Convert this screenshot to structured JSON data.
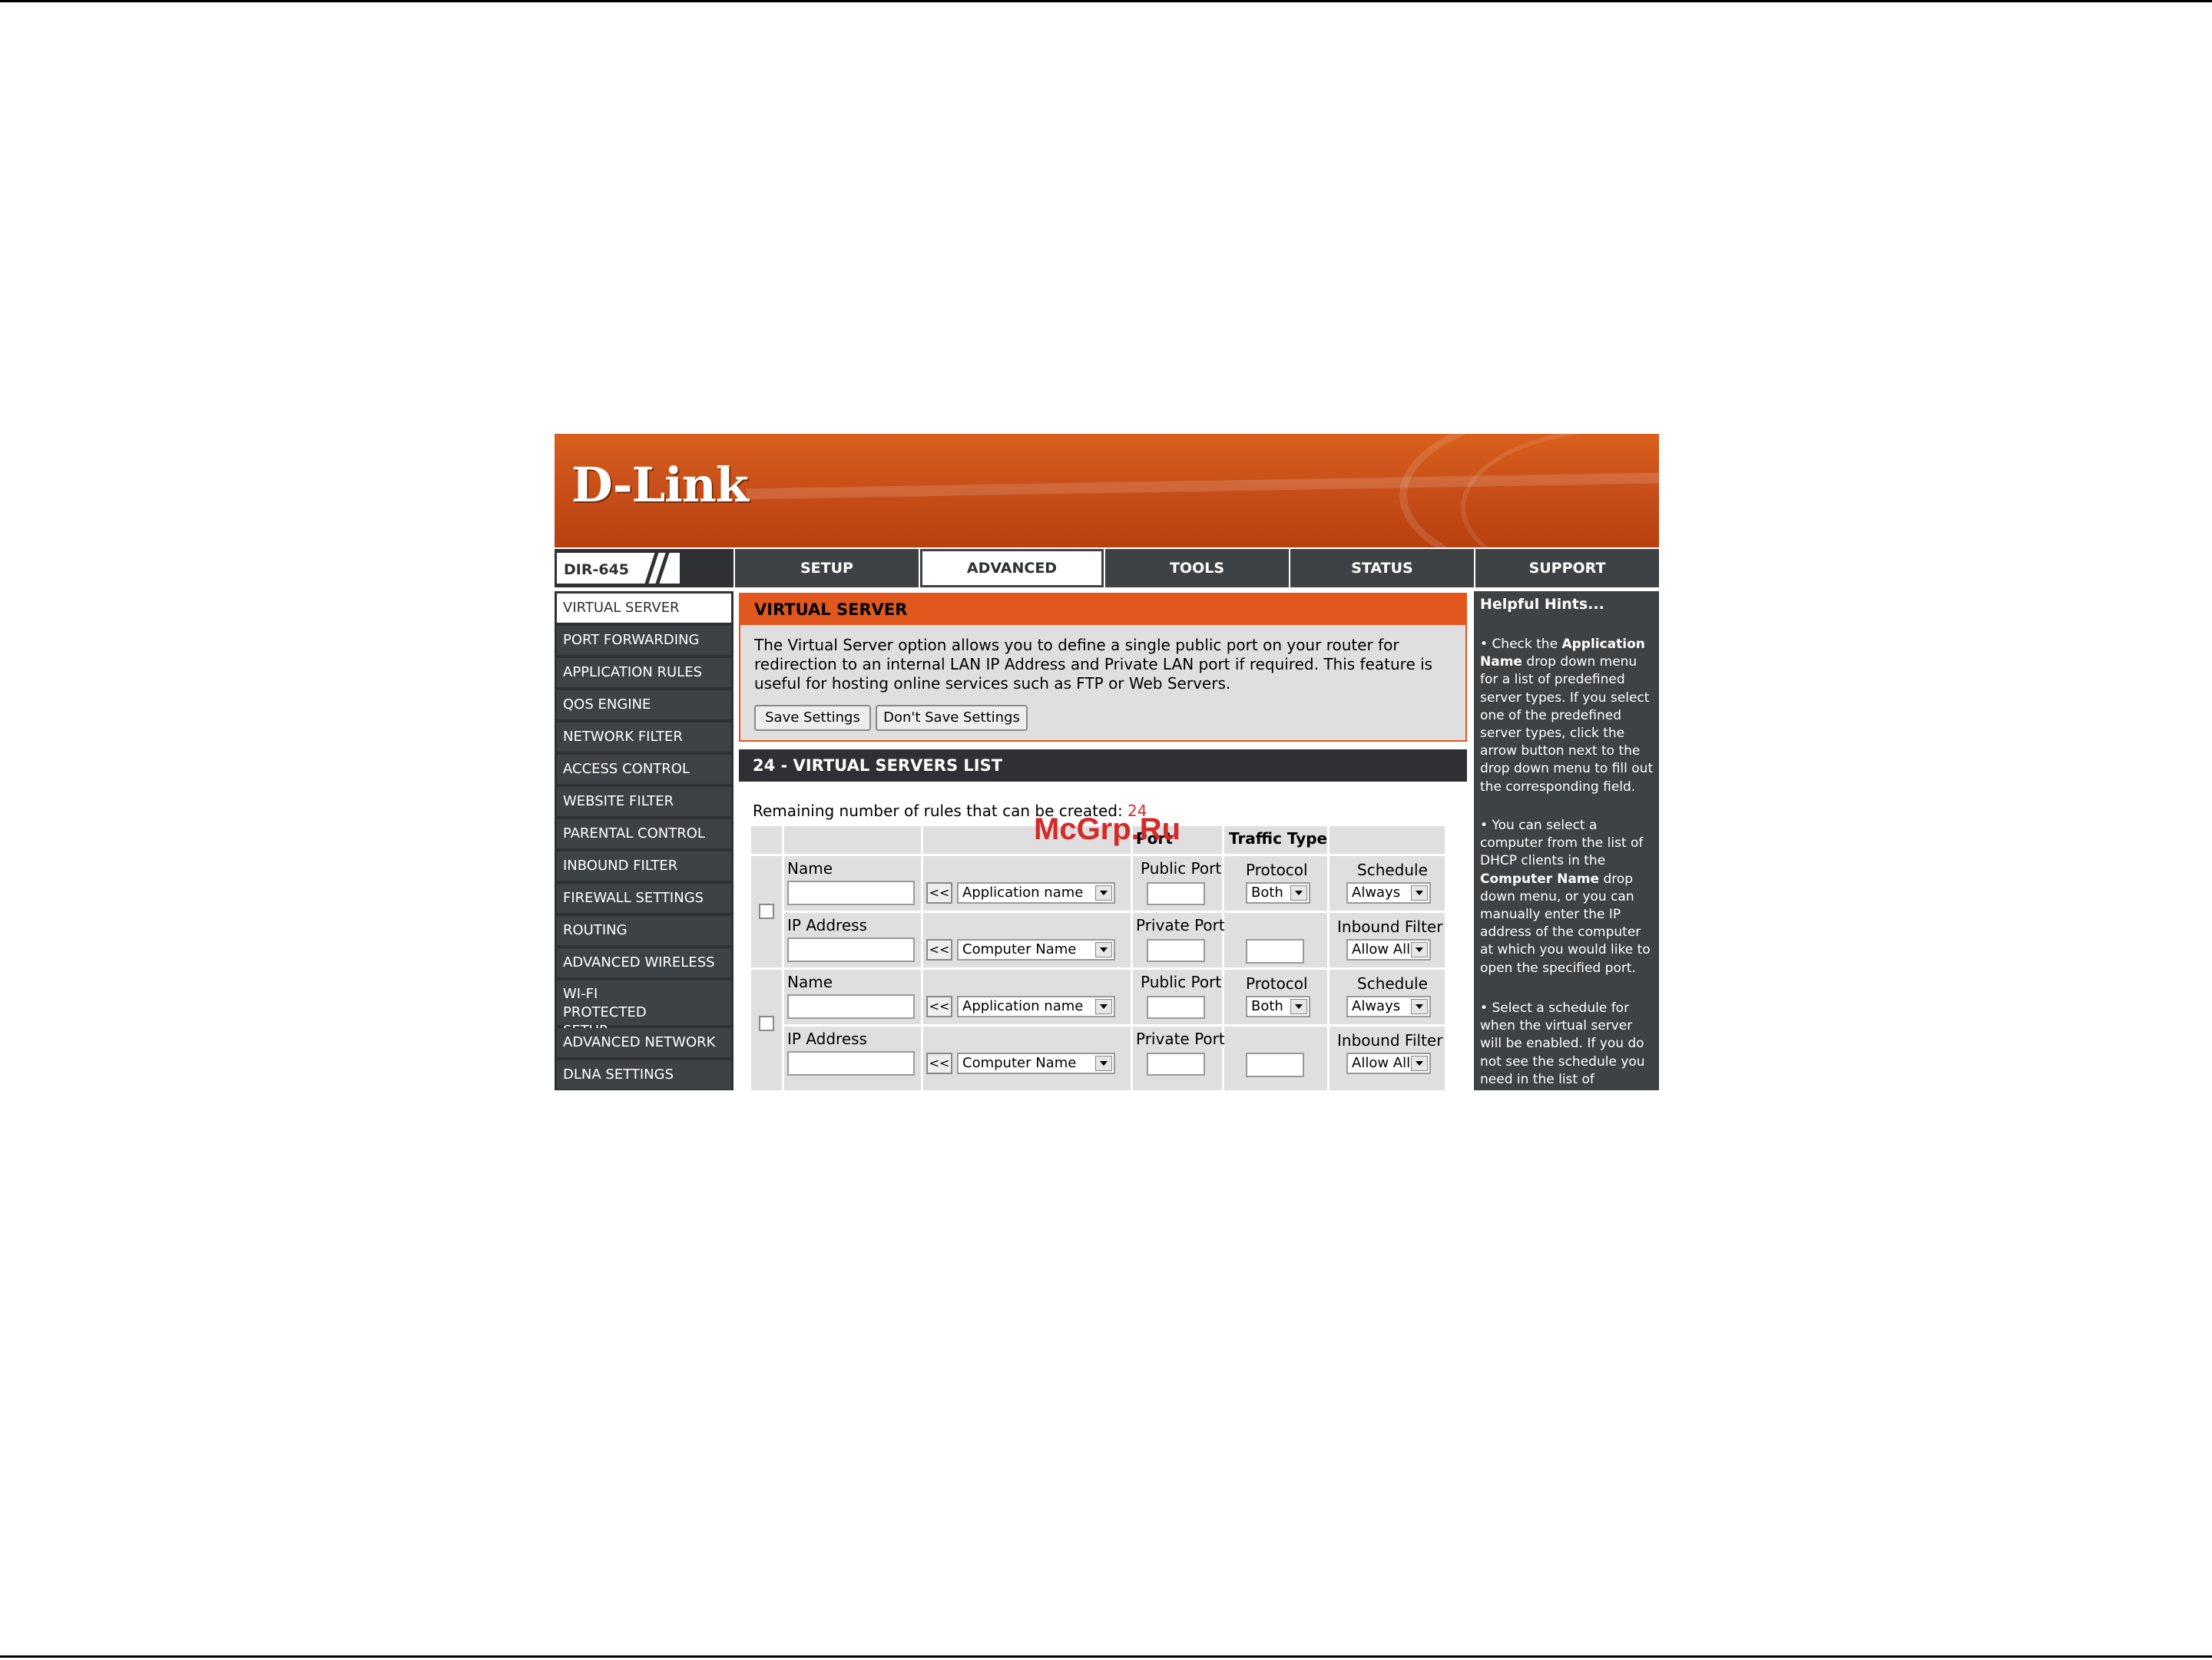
{
  "brand": {
    "logo_text": "D-Link",
    "model": "DIR-645"
  },
  "nav": {
    "tabs": [
      {
        "label": "SETUP"
      },
      {
        "label": "ADVANCED"
      },
      {
        "label": "TOOLS"
      },
      {
        "label": "STATUS"
      },
      {
        "label": "SUPPORT"
      }
    ],
    "active": "ADVANCED"
  },
  "sidebar": {
    "items": [
      {
        "label": "VIRTUAL SERVER"
      },
      {
        "label": "PORT FORWARDING"
      },
      {
        "label": "APPLICATION RULES"
      },
      {
        "label": "QOS ENGINE"
      },
      {
        "label": "NETWORK FILTER"
      },
      {
        "label": "ACCESS CONTROL"
      },
      {
        "label": "WEBSITE FILTER"
      },
      {
        "label": "PARENTAL CONTROL"
      },
      {
        "label": "INBOUND FILTER"
      },
      {
        "label": "FIREWALL SETTINGS"
      },
      {
        "label": "ROUTING"
      },
      {
        "label": "ADVANCED WIRELESS"
      },
      {
        "label": "WI-FI PROTECTED SETUP"
      },
      {
        "label": "ADVANCED NETWORK"
      },
      {
        "label": "DLNA SETTINGS"
      }
    ],
    "active": "VIRTUAL SERVER"
  },
  "virtual_server": {
    "title": "VIRTUAL SERVER",
    "description": "The Virtual Server option allows you to define a single public port on your router for redirection to an internal LAN IP Address and Private LAN port if required. This feature is useful for hosting online services such as FTP or Web Servers.",
    "save_label": "Save Settings",
    "dont_save_label": "Don't Save Settings"
  },
  "list": {
    "title": "24 - VIRTUAL SERVERS LIST",
    "remaining_label": "Remaining number of rules that can be created:",
    "remaining_count": "24",
    "header_port": "Port",
    "header_traffic": "Traffic Type",
    "rows": [
      {
        "name_label": "Name",
        "name_value": "",
        "arrow_label": "<<",
        "app_select": "Application name",
        "public_port_label": "Public Port",
        "public_port_value": "",
        "protocol_label": "Protocol",
        "protocol_value": "Both",
        "schedule_label": "Schedule",
        "schedule_value": "Always",
        "ip_label": "IP Address",
        "ip_value": "",
        "computer_select": "Computer Name",
        "private_port_label": "Private Port",
        "private_port_value": "",
        "protocol_num_value": "",
        "inbound_label": "Inbound Filter",
        "inbound_value": "Allow All"
      },
      {
        "name_label": "Name",
        "name_value": "",
        "arrow_label": "<<",
        "app_select": "Application name",
        "public_port_label": "Public Port",
        "public_port_value": "",
        "protocol_label": "Protocol",
        "protocol_value": "Both",
        "schedule_label": "Schedule",
        "schedule_value": "Always",
        "ip_label": "IP Address",
        "ip_value": "",
        "computer_select": "Computer Name",
        "private_port_label": "Private Port",
        "private_port_value": "",
        "protocol_num_value": "",
        "inbound_label": "Inbound Filter",
        "inbound_value": "Allow All"
      }
    ]
  },
  "hints": {
    "title": "Helpful Hints...",
    "items": [
      {
        "pre": "Check the ",
        "bold": "Application Name",
        "post": " drop down menu for a list of predefined server types. If you select one of the predefined server types, click the arrow button next to the drop down menu to fill out the corresponding field."
      },
      {
        "pre": "You can select a computer from the list of DHCP clients in the ",
        "bold": "Computer Name",
        "post": " drop down menu, or you can manually enter the IP address of the computer at which you would like to open the specified port."
      },
      {
        "pre": "Select a schedule for when the virtual server will be enabled. If you do not see the schedule you need in the list of",
        "bold": "",
        "post": ""
      }
    ]
  },
  "watermark": "McGrp.Ru"
}
